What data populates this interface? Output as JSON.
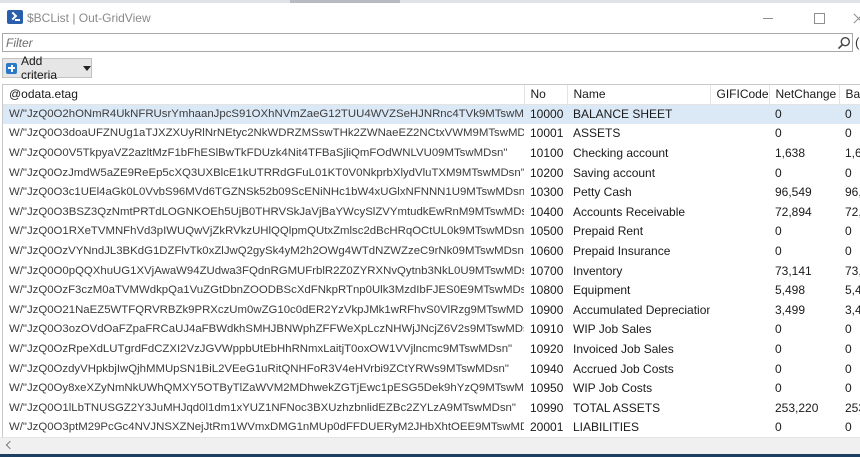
{
  "window": {
    "title": "$BCList | Out-GridView"
  },
  "filter": {
    "placeholder": "Filter"
  },
  "toolbar": {
    "add_criteria_label": "Add criteria"
  },
  "icons": {
    "app": "powershell-icon",
    "search": "search-icon",
    "add": "plus-icon",
    "dropdown": "chevron-down-icon"
  },
  "colors": {
    "selected_row": "#dbe8f6",
    "plus_icon": "#2a78c8",
    "app_icon": "#2b5fad"
  },
  "grid": {
    "columns": [
      "@odata.etag",
      "No",
      "Name",
      "GIFICode",
      "NetChange",
      "Bala"
    ],
    "rows": [
      [
        "W/\"JzQ0O2hONmR4UkNFRUsrYmhaanJpcS91OXhNVmZaeG12TUU4WVZSeHJNRnc4TVk9MTswMDsn\"",
        "10000",
        "BALANCE SHEET",
        "",
        "0",
        "0"
      ],
      [
        "W/\"JzQ0O3doaUFZNUg1aTJXZXUyRlNrNEtyc2NkWDRZMSswTHk2ZWNaeEZ2NCtxVWM9MTswMDsn\"",
        "10001",
        "ASSETS",
        "",
        "0",
        "0"
      ],
      [
        "W/\"JzQ0O0V5TkpyaVZ2azltMzF1bFhESlBwTkFDUzk4Nit4TFBaSjliQmFOdWNLVU09MTswMDsn\"",
        "10100",
        "Checking account",
        "",
        "1,638",
        "1,63"
      ],
      [
        "W/\"JzQ0OzJmdW5aZE9ReEp5cXQ3UXBlcE1kUTRRdGFuL01KT0V0NkprbXlydVluTXM9MTswMDsn\"",
        "10200",
        "Saving account",
        "",
        "0",
        "0"
      ],
      [
        "W/\"JzQ0O3c1UEl4aGk0L0VvbS96MVd6TGZNSk52b09ScENiNHc1bW4xUGlxNFNNN1U9MTswMDsn\"",
        "10300",
        "Petty Cash",
        "",
        "96,549",
        "96,5"
      ],
      [
        "W/\"JzQ0O3BSZ3QzNmtPRTdLOGNKOEh5UjB0THRVSkJaVjBaYWcySlZVYmtudkEwRnM9MTswMDsn\"",
        "10400",
        "Accounts Receivable",
        "",
        "72,894",
        "72,8"
      ],
      [
        "W/\"JzQ0O1RXeTVMNFhVd3pIWUQwVjZkRVkzUHlQQlpmQUtxZmlsc2dBcHRqOCtUL0k9MTswMDsn\"",
        "10500",
        "Prepaid Rent",
        "",
        "0",
        "0"
      ],
      [
        "W/\"JzQ0OzVYNndJL3BKdG1DZFlvTk0xZlJwQ2gySk4yM2h2OWg4WTdNZWZzeC9rNk09MTswMDsn\"",
        "10600",
        "Prepaid Insurance",
        "",
        "0",
        "0"
      ],
      [
        "W/\"JzQ0O0pQQXhuUG1XVjAwaW94ZUdwa3FQdnRGMUFrblR2Z0ZYRXNvQytnb3NkL0U9MTswMDsn\"",
        "10700",
        "Inventory",
        "",
        "73,141",
        "73,1"
      ],
      [
        "W/\"JzQ0OzF3czM0aTVMWdkpQa1VuZGtDbnZOODBScXdFNkpRTnp0Ulk3MzdIbFJES0E9MTswMDsn\"",
        "10800",
        "Equipment",
        "",
        "5,498",
        "5,49"
      ],
      [
        "W/\"JzQ0O21NaEZ5WTFQRVRBZk9PRXczUm0wZG10c0dER2YzVkpJMk1wRFhvS0VlRzg9MTswMDsn\"",
        "10900",
        "Accumulated Depreciation",
        "",
        "3,499",
        "3,49"
      ],
      [
        "W/\"JzQ0O3ozOVdOaFZpaFRCaUJ4aFBWdkhSMHJBNWphZFFWeXpLczNHWjJNcjZ6V2s9MTswMDsn\"",
        "10910",
        "WIP Job Sales",
        "",
        "0",
        "0"
      ],
      [
        "W/\"JzQ0OzRpeXdLUTgrdFdCZXI2VzJGVWppbUtEbHhRNmxLaitjT0oxOW1VVjlncmc9MTswMDsn\"",
        "10920",
        "Invoiced Job Sales",
        "",
        "0",
        "0"
      ],
      [
        "W/\"JzQ0OzdyVHpkbjIwQjhMMUpSN1BiL2VEeG1uRitQNHFoR3V4eHVrbi9ZCtYRWs9MTswMDsn\"",
        "10940",
        "Accrued Job Costs",
        "",
        "0",
        "0"
      ],
      [
        "W/\"JzQ0Oy8xeXZyNmNkUWhQMXY5OTByTlZaWVM2MDhwekZGTjEwc1pESG5Dek9hYzQ9MTswMDsn\"",
        "10950",
        "WIP Job Costs",
        "",
        "0",
        "0"
      ],
      [
        "W/\"JzQ0O1lLbTNUSGZ2Y3JuMHJqd0l1dm1xYUZ1NFNoc3BXUzhzbnlidEZBc2ZYLzA9MTswMDsn\"",
        "10990",
        "TOTAL ASSETS",
        "",
        "253,220",
        "253,"
      ],
      [
        "W/\"JzQ0O3ptM29PcGc4NVJNSXZNejJtRm1WVmxDMG1nMUp0dFFDUERyM2JHbXhtOEE9MTswMDsn\"",
        "20001",
        "LIABILITIES",
        "",
        "0",
        "0"
      ]
    ]
  }
}
